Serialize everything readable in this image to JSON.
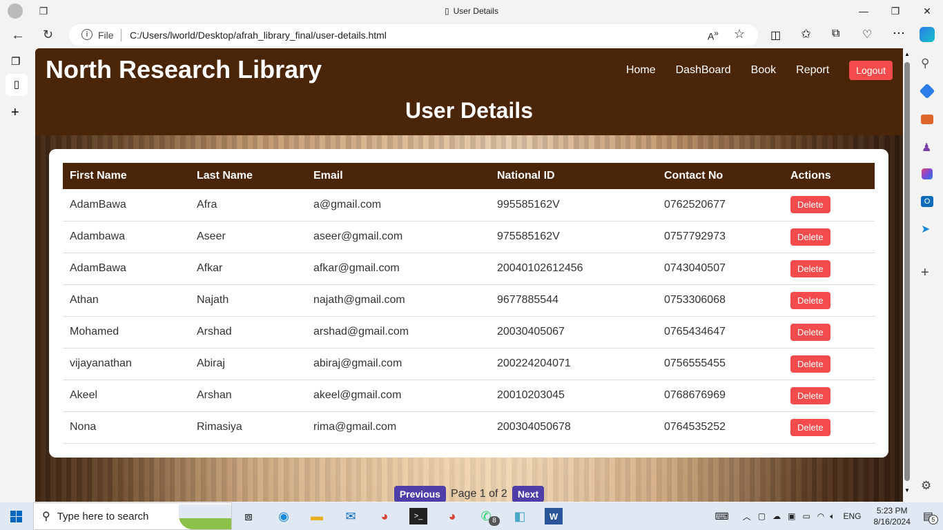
{
  "browser": {
    "tab_title": "User Details",
    "url_prefix": "File",
    "url": "C:/Users/lworld/Desktop/afrah_library_final/user-details.html"
  },
  "site": {
    "brand": "North Research Library",
    "nav": [
      "Home",
      "DashBoard",
      "Book",
      "Report"
    ],
    "logout": "Logout",
    "page_title": "User Details"
  },
  "table": {
    "headers": [
      "First Name",
      "Last Name",
      "Email",
      "National ID",
      "Contact No",
      "Actions"
    ],
    "rows": [
      [
        "AdamBawa",
        "Afra",
        "a@gmail.com",
        "995585162V",
        "0762520677"
      ],
      [
        "Adambawa",
        "Aseer",
        "aseer@gmail.com",
        "975585162V",
        "0757792973"
      ],
      [
        "AdamBawa",
        "Afkar",
        "afkar@gmail.com",
        "20040102612456",
        "0743040507"
      ],
      [
        "Athan",
        "Najath",
        "najath@gmail.com",
        "9677885544",
        "0753306068"
      ],
      [
        "Mohamed",
        "Arshad",
        "arshad@gmail.com",
        "20030405067",
        "0765434647"
      ],
      [
        "vijayanathan",
        "Abiraj",
        "abiraj@gmail.com",
        "200224204071",
        "0756555455"
      ],
      [
        "Akeel",
        "Arshan",
        "akeel@gmail.com",
        "20010203045",
        "0768676969"
      ],
      [
        "Nona",
        "Rimasiya",
        "rima@gmail.com",
        "200304050678",
        "0764535252"
      ]
    ],
    "delete_label": "Delete"
  },
  "pager": {
    "prev": "Previous",
    "status": "Page 1 of 2",
    "next": "Next"
  },
  "taskbar": {
    "search_placeholder": "Type here to search",
    "lang": "ENG",
    "time": "5:23 PM",
    "date": "8/16/2024",
    "whatsapp_badge": "8",
    "notif_badge": "5"
  },
  "colors": {
    "header": "#4a2508",
    "delete": "#f44c4c",
    "pager": "#4d3ea8"
  }
}
